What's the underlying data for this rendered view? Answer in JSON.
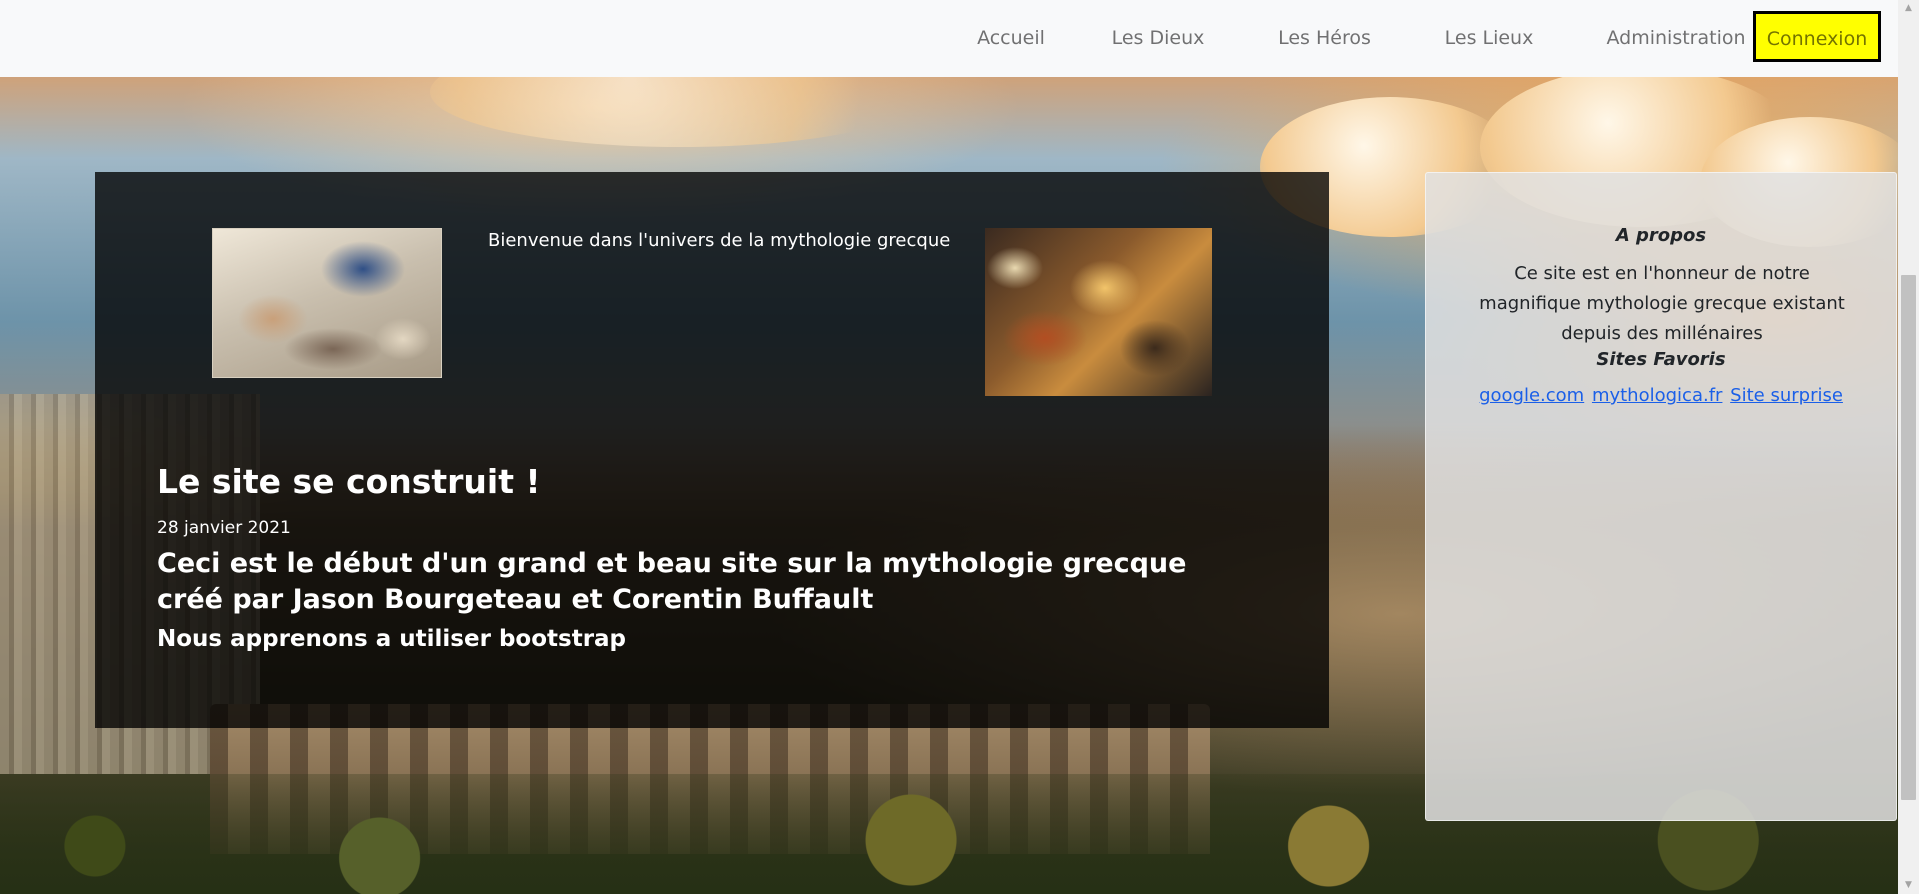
{
  "nav": {
    "items": [
      "Accueil",
      "Les Dieux",
      "Les Héros",
      "Les Lieux",
      "Administration"
    ],
    "connexion": "Connexion",
    "connexion_bg": "#ffff00"
  },
  "main": {
    "welcome": "Bienvenue dans l'univers de la mythologie grecque",
    "title": "Le site se construit !",
    "date": "28 janvier 2021",
    "body": "Ceci est le début d'un grand et beau site sur la mythologie grecque créé par Jason Bourgeteau et Corentin Buffault",
    "sub": "Nous apprenons a utiliser bootstrap"
  },
  "about": {
    "title": "A propos",
    "text": "Ce site est en l'honneur de notre magnifique mythologie grecque existant depuis des millénaires",
    "favorites_title": "Sites Favoris",
    "links": [
      "google.com",
      "mythologica.fr",
      "Site surprise"
    ]
  }
}
